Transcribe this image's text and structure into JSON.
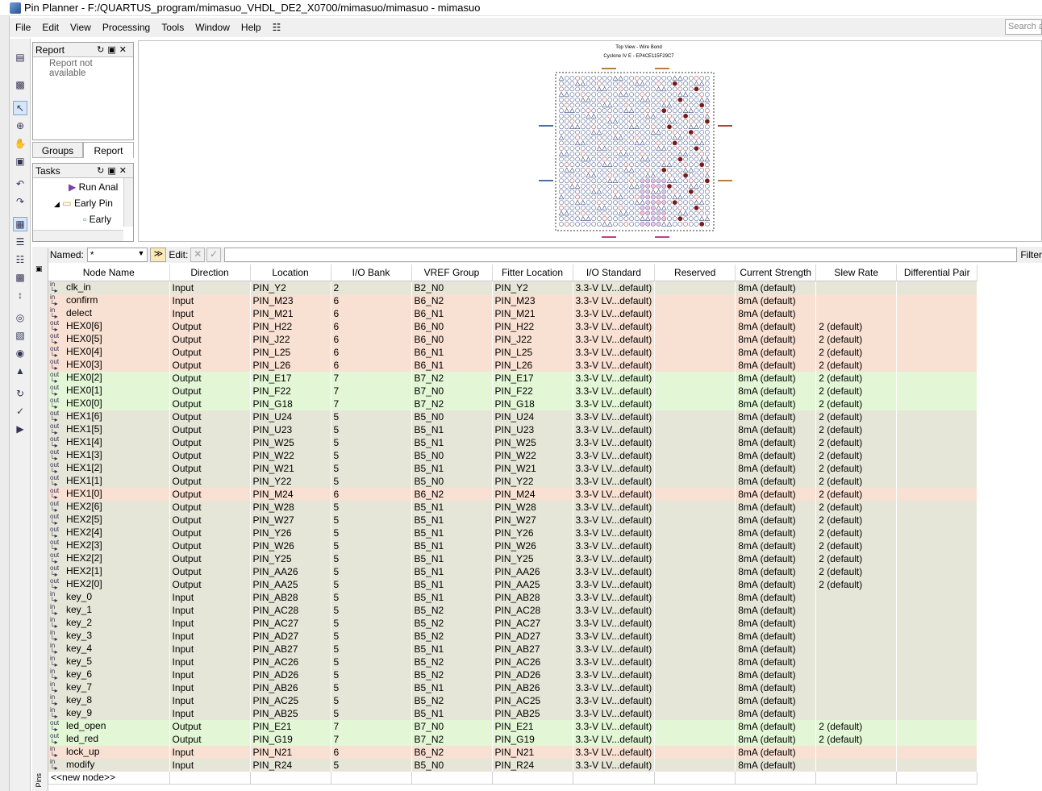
{
  "window": {
    "title": "Pin Planner - F:/QUARTUS_program/mimasuo_VHDL_DE2_X0700/mimasuo/mimasuo - mimasuo"
  },
  "menu": [
    "File",
    "Edit",
    "View",
    "Processing",
    "Tools",
    "Window",
    "Help"
  ],
  "search_placeholder": "Search a",
  "report_panel": {
    "title": "Report",
    "message": "Report not available",
    "tabs": [
      "Groups",
      "Report"
    ]
  },
  "tasks_panel": {
    "title": "Tasks",
    "items": [
      "Run Anal",
      "Early Pin",
      "Early"
    ]
  },
  "chip": {
    "title": "Top View - Wire Bond",
    "device": "Cyclone IV E - EP4CE115F29C7"
  },
  "named_bar": {
    "named_label": "Named:",
    "named_value": "*",
    "edit_label": "Edit:",
    "filter_label": "Filter"
  },
  "side_label": "Pins",
  "columns": [
    "Node Name",
    "Direction",
    "Location",
    "I/O Bank",
    "VREF Group",
    "Fitter Location",
    "I/O Standard",
    "Reserved",
    "Current Strength",
    "Slew Rate",
    "Differential Pair"
  ],
  "rows": [
    {
      "color": "gray",
      "io": "in",
      "name": "clk_in",
      "dir": "Input",
      "loc": "PIN_Y2",
      "bank": "2",
      "vref": "B2_N0",
      "fit": "PIN_Y2",
      "std": "3.3-V LV...default)",
      "res": "",
      "cur": "8mA (default)",
      "slew": "",
      "diff": ""
    },
    {
      "color": "orange",
      "io": "in",
      "name": "confirm",
      "dir": "Input",
      "loc": "PIN_M23",
      "bank": "6",
      "vref": "B6_N2",
      "fit": "PIN_M23",
      "std": "3.3-V LV...default)",
      "res": "",
      "cur": "8mA (default)",
      "slew": "",
      "diff": ""
    },
    {
      "color": "orange",
      "io": "in",
      "name": "delect",
      "dir": "Input",
      "loc": "PIN_M21",
      "bank": "6",
      "vref": "B6_N1",
      "fit": "PIN_M21",
      "std": "3.3-V LV...default)",
      "res": "",
      "cur": "8mA (default)",
      "slew": "",
      "diff": ""
    },
    {
      "color": "orange",
      "io": "out",
      "name": "HEX0[6]",
      "dir": "Output",
      "loc": "PIN_H22",
      "bank": "6",
      "vref": "B6_N0",
      "fit": "PIN_H22",
      "std": "3.3-V LV...default)",
      "res": "",
      "cur": "8mA (default)",
      "slew": "2 (default)",
      "diff": ""
    },
    {
      "color": "orange",
      "io": "out",
      "name": "HEX0[5]",
      "dir": "Output",
      "loc": "PIN_J22",
      "bank": "6",
      "vref": "B6_N0",
      "fit": "PIN_J22",
      "std": "3.3-V LV...default)",
      "res": "",
      "cur": "8mA (default)",
      "slew": "2 (default)",
      "diff": ""
    },
    {
      "color": "orange",
      "io": "out",
      "name": "HEX0[4]",
      "dir": "Output",
      "loc": "PIN_L25",
      "bank": "6",
      "vref": "B6_N1",
      "fit": "PIN_L25",
      "std": "3.3-V LV...default)",
      "res": "",
      "cur": "8mA (default)",
      "slew": "2 (default)",
      "diff": ""
    },
    {
      "color": "orange",
      "io": "out",
      "name": "HEX0[3]",
      "dir": "Output",
      "loc": "PIN_L26",
      "bank": "6",
      "vref": "B6_N1",
      "fit": "PIN_L26",
      "std": "3.3-V LV...default)",
      "res": "",
      "cur": "8mA (default)",
      "slew": "2 (default)",
      "diff": ""
    },
    {
      "color": "green",
      "io": "out",
      "name": "HEX0[2]",
      "dir": "Output",
      "loc": "PIN_E17",
      "bank": "7",
      "vref": "B7_N2",
      "fit": "PIN_E17",
      "std": "3.3-V LV...default)",
      "res": "",
      "cur": "8mA (default)",
      "slew": "2 (default)",
      "diff": ""
    },
    {
      "color": "green",
      "io": "out",
      "name": "HEX0[1]",
      "dir": "Output",
      "loc": "PIN_F22",
      "bank": "7",
      "vref": "B7_N0",
      "fit": "PIN_F22",
      "std": "3.3-V LV...default)",
      "res": "",
      "cur": "8mA (default)",
      "slew": "2 (default)",
      "diff": ""
    },
    {
      "color": "green",
      "io": "out",
      "name": "HEX0[0]",
      "dir": "Output",
      "loc": "PIN_G18",
      "bank": "7",
      "vref": "B7_N2",
      "fit": "PIN_G18",
      "std": "3.3-V LV...default)",
      "res": "",
      "cur": "8mA (default)",
      "slew": "2 (default)",
      "diff": ""
    },
    {
      "color": "gray",
      "io": "out",
      "name": "HEX1[6]",
      "dir": "Output",
      "loc": "PIN_U24",
      "bank": "5",
      "vref": "B5_N0",
      "fit": "PIN_U24",
      "std": "3.3-V LV...default)",
      "res": "",
      "cur": "8mA (default)",
      "slew": "2 (default)",
      "diff": ""
    },
    {
      "color": "gray",
      "io": "out",
      "name": "HEX1[5]",
      "dir": "Output",
      "loc": "PIN_U23",
      "bank": "5",
      "vref": "B5_N1",
      "fit": "PIN_U23",
      "std": "3.3-V LV...default)",
      "res": "",
      "cur": "8mA (default)",
      "slew": "2 (default)",
      "diff": ""
    },
    {
      "color": "gray",
      "io": "out",
      "name": "HEX1[4]",
      "dir": "Output",
      "loc": "PIN_W25",
      "bank": "5",
      "vref": "B5_N1",
      "fit": "PIN_W25",
      "std": "3.3-V LV...default)",
      "res": "",
      "cur": "8mA (default)",
      "slew": "2 (default)",
      "diff": ""
    },
    {
      "color": "gray",
      "io": "out",
      "name": "HEX1[3]",
      "dir": "Output",
      "loc": "PIN_W22",
      "bank": "5",
      "vref": "B5_N0",
      "fit": "PIN_W22",
      "std": "3.3-V LV...default)",
      "res": "",
      "cur": "8mA (default)",
      "slew": "2 (default)",
      "diff": ""
    },
    {
      "color": "gray",
      "io": "out",
      "name": "HEX1[2]",
      "dir": "Output",
      "loc": "PIN_W21",
      "bank": "5",
      "vref": "B5_N1",
      "fit": "PIN_W21",
      "std": "3.3-V LV...default)",
      "res": "",
      "cur": "8mA (default)",
      "slew": "2 (default)",
      "diff": ""
    },
    {
      "color": "gray",
      "io": "out",
      "name": "HEX1[1]",
      "dir": "Output",
      "loc": "PIN_Y22",
      "bank": "5",
      "vref": "B5_N0",
      "fit": "PIN_Y22",
      "std": "3.3-V LV...default)",
      "res": "",
      "cur": "8mA (default)",
      "slew": "2 (default)",
      "diff": ""
    },
    {
      "color": "orange",
      "io": "out",
      "name": "HEX1[0]",
      "dir": "Output",
      "loc": "PIN_M24",
      "bank": "6",
      "vref": "B6_N2",
      "fit": "PIN_M24",
      "std": "3.3-V LV...default)",
      "res": "",
      "cur": "8mA (default)",
      "slew": "2 (default)",
      "diff": ""
    },
    {
      "color": "gray",
      "io": "out",
      "name": "HEX2[6]",
      "dir": "Output",
      "loc": "PIN_W28",
      "bank": "5",
      "vref": "B5_N1",
      "fit": "PIN_W28",
      "std": "3.3-V LV...default)",
      "res": "",
      "cur": "8mA (default)",
      "slew": "2 (default)",
      "diff": ""
    },
    {
      "color": "gray",
      "io": "out",
      "name": "HEX2[5]",
      "dir": "Output",
      "loc": "PIN_W27",
      "bank": "5",
      "vref": "B5_N1",
      "fit": "PIN_W27",
      "std": "3.3-V LV...default)",
      "res": "",
      "cur": "8mA (default)",
      "slew": "2 (default)",
      "diff": ""
    },
    {
      "color": "gray",
      "io": "out",
      "name": "HEX2[4]",
      "dir": "Output",
      "loc": "PIN_Y26",
      "bank": "5",
      "vref": "B5_N1",
      "fit": "PIN_Y26",
      "std": "3.3-V LV...default)",
      "res": "",
      "cur": "8mA (default)",
      "slew": "2 (default)",
      "diff": ""
    },
    {
      "color": "gray",
      "io": "out",
      "name": "HEX2[3]",
      "dir": "Output",
      "loc": "PIN_W26",
      "bank": "5",
      "vref": "B5_N1",
      "fit": "PIN_W26",
      "std": "3.3-V LV...default)",
      "res": "",
      "cur": "8mA (default)",
      "slew": "2 (default)",
      "diff": ""
    },
    {
      "color": "gray",
      "io": "out",
      "name": "HEX2[2]",
      "dir": "Output",
      "loc": "PIN_Y25",
      "bank": "5",
      "vref": "B5_N1",
      "fit": "PIN_Y25",
      "std": "3.3-V LV...default)",
      "res": "",
      "cur": "8mA (default)",
      "slew": "2 (default)",
      "diff": ""
    },
    {
      "color": "gray",
      "io": "out",
      "name": "HEX2[1]",
      "dir": "Output",
      "loc": "PIN_AA26",
      "bank": "5",
      "vref": "B5_N1",
      "fit": "PIN_AA26",
      "std": "3.3-V LV...default)",
      "res": "",
      "cur": "8mA (default)",
      "slew": "2 (default)",
      "diff": ""
    },
    {
      "color": "gray",
      "io": "out",
      "name": "HEX2[0]",
      "dir": "Output",
      "loc": "PIN_AA25",
      "bank": "5",
      "vref": "B5_N1",
      "fit": "PIN_AA25",
      "std": "3.3-V LV...default)",
      "res": "",
      "cur": "8mA (default)",
      "slew": "2 (default)",
      "diff": ""
    },
    {
      "color": "gray",
      "io": "in",
      "name": "key_0",
      "dir": "Input",
      "loc": "PIN_AB28",
      "bank": "5",
      "vref": "B5_N1",
      "fit": "PIN_AB28",
      "std": "3.3-V LV...default)",
      "res": "",
      "cur": "8mA (default)",
      "slew": "",
      "diff": ""
    },
    {
      "color": "gray",
      "io": "in",
      "name": "key_1",
      "dir": "Input",
      "loc": "PIN_AC28",
      "bank": "5",
      "vref": "B5_N2",
      "fit": "PIN_AC28",
      "std": "3.3-V LV...default)",
      "res": "",
      "cur": "8mA (default)",
      "slew": "",
      "diff": ""
    },
    {
      "color": "gray",
      "io": "in",
      "name": "key_2",
      "dir": "Input",
      "loc": "PIN_AC27",
      "bank": "5",
      "vref": "B5_N2",
      "fit": "PIN_AC27",
      "std": "3.3-V LV...default)",
      "res": "",
      "cur": "8mA (default)",
      "slew": "",
      "diff": ""
    },
    {
      "color": "gray",
      "io": "in",
      "name": "key_3",
      "dir": "Input",
      "loc": "PIN_AD27",
      "bank": "5",
      "vref": "B5_N2",
      "fit": "PIN_AD27",
      "std": "3.3-V LV...default)",
      "res": "",
      "cur": "8mA (default)",
      "slew": "",
      "diff": ""
    },
    {
      "color": "gray",
      "io": "in",
      "name": "key_4",
      "dir": "Input",
      "loc": "PIN_AB27",
      "bank": "5",
      "vref": "B5_N1",
      "fit": "PIN_AB27",
      "std": "3.3-V LV...default)",
      "res": "",
      "cur": "8mA (default)",
      "slew": "",
      "diff": ""
    },
    {
      "color": "gray",
      "io": "in",
      "name": "key_5",
      "dir": "Input",
      "loc": "PIN_AC26",
      "bank": "5",
      "vref": "B5_N2",
      "fit": "PIN_AC26",
      "std": "3.3-V LV...default)",
      "res": "",
      "cur": "8mA (default)",
      "slew": "",
      "diff": ""
    },
    {
      "color": "gray",
      "io": "in",
      "name": "key_6",
      "dir": "Input",
      "loc": "PIN_AD26",
      "bank": "5",
      "vref": "B5_N2",
      "fit": "PIN_AD26",
      "std": "3.3-V LV...default)",
      "res": "",
      "cur": "8mA (default)",
      "slew": "",
      "diff": ""
    },
    {
      "color": "gray",
      "io": "in",
      "name": "key_7",
      "dir": "Input",
      "loc": "PIN_AB26",
      "bank": "5",
      "vref": "B5_N1",
      "fit": "PIN_AB26",
      "std": "3.3-V LV...default)",
      "res": "",
      "cur": "8mA (default)",
      "slew": "",
      "diff": ""
    },
    {
      "color": "gray",
      "io": "in",
      "name": "key_8",
      "dir": "Input",
      "loc": "PIN_AC25",
      "bank": "5",
      "vref": "B5_N2",
      "fit": "PIN_AC25",
      "std": "3.3-V LV...default)",
      "res": "",
      "cur": "8mA (default)",
      "slew": "",
      "diff": ""
    },
    {
      "color": "gray",
      "io": "in",
      "name": "key_9",
      "dir": "Input",
      "loc": "PIN_AB25",
      "bank": "5",
      "vref": "B5_N1",
      "fit": "PIN_AB25",
      "std": "3.3-V LV...default)",
      "res": "",
      "cur": "8mA (default)",
      "slew": "",
      "diff": ""
    },
    {
      "color": "green",
      "io": "out",
      "name": "led_open",
      "dir": "Output",
      "loc": "PIN_E21",
      "bank": "7",
      "vref": "B7_N0",
      "fit": "PIN_E21",
      "std": "3.3-V LV...default)",
      "res": "",
      "cur": "8mA (default)",
      "slew": "2 (default)",
      "diff": ""
    },
    {
      "color": "green",
      "io": "out",
      "name": "led_red",
      "dir": "Output",
      "loc": "PIN_G19",
      "bank": "7",
      "vref": "B7_N2",
      "fit": "PIN_G19",
      "std": "3.3-V LV...default)",
      "res": "",
      "cur": "8mA (default)",
      "slew": "2 (default)",
      "diff": ""
    },
    {
      "color": "orange",
      "io": "in",
      "name": "lock_up",
      "dir": "Input",
      "loc": "PIN_N21",
      "bank": "6",
      "vref": "B6_N2",
      "fit": "PIN_N21",
      "std": "3.3-V LV...default)",
      "res": "",
      "cur": "8mA (default)",
      "slew": "",
      "diff": ""
    },
    {
      "color": "gray",
      "io": "in",
      "name": "modify",
      "dir": "Input",
      "loc": "PIN_R24",
      "bank": "5",
      "vref": "B5_N0",
      "fit": "PIN_R24",
      "std": "3.3-V LV...default)",
      "res": "",
      "cur": "8mA (default)",
      "slew": "",
      "diff": ""
    }
  ],
  "new_node": "<<new node>>",
  "colors": {
    "orange": "#f8e0d2",
    "green": "#e3f7d6",
    "gray": "#e6e6d8"
  }
}
